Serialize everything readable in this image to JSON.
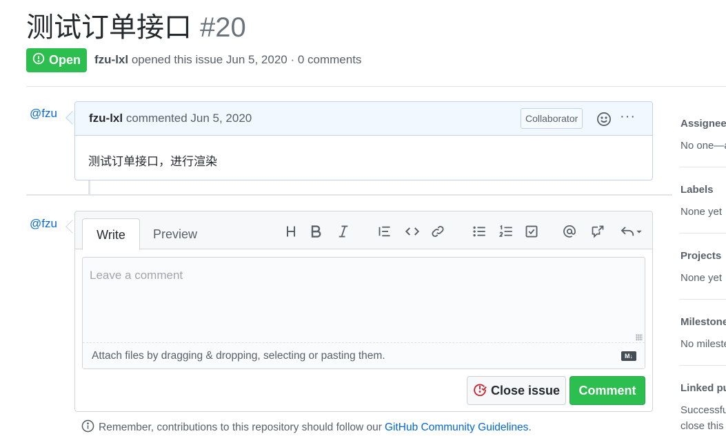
{
  "issue": {
    "title": "测试订单接口",
    "number": "#20",
    "state": "Open",
    "author": "fzu-lxl",
    "meta_text": "opened this issue Jun 5, 2020 · 0 comments"
  },
  "timeline": {
    "avatar1": "@fzu",
    "avatar2": "@fzu"
  },
  "comment": {
    "author": "fzu-lxl",
    "header_text": "commented Jun 5, 2020",
    "badge": "Collaborator",
    "more": "···",
    "body": "测试订单接口，进行渲染"
  },
  "form": {
    "tab_write": "Write",
    "tab_preview": "Preview",
    "placeholder": "Leave a comment",
    "attach_text": "Attach files by dragging & dropping, selecting or pasting them.",
    "md_badge": "M↓",
    "close_label": "Close issue",
    "comment_label": "Comment",
    "toolbar": [
      "heading-icon",
      "bold-icon",
      "italic-icon",
      "quote-icon",
      "code-icon",
      "link-icon",
      "bulleted-list-icon",
      "numbered-list-icon",
      "task-list-icon",
      "mention-icon",
      "cross-reference-icon",
      "reply-icon"
    ]
  },
  "note": {
    "text": "Remember, contributions to this repository should follow our",
    "link": "GitHub Community Guidelines",
    "end": "."
  },
  "sidebar": {
    "assignees_h": "Assignees",
    "assignees_v": "No one—a",
    "labels_h": "Labels",
    "labels_v": "None yet",
    "projects_h": "Projects",
    "projects_v": "None yet",
    "milestone_h": "Milestone",
    "milestone_v": "No mileste",
    "linked_h": "Linked pu",
    "linked_v1": "Successful",
    "linked_v2": "close this"
  },
  "colors": {
    "open_green": "#2cbe4e",
    "link_blue": "#0366d6",
    "close_red": "#cb2431"
  }
}
